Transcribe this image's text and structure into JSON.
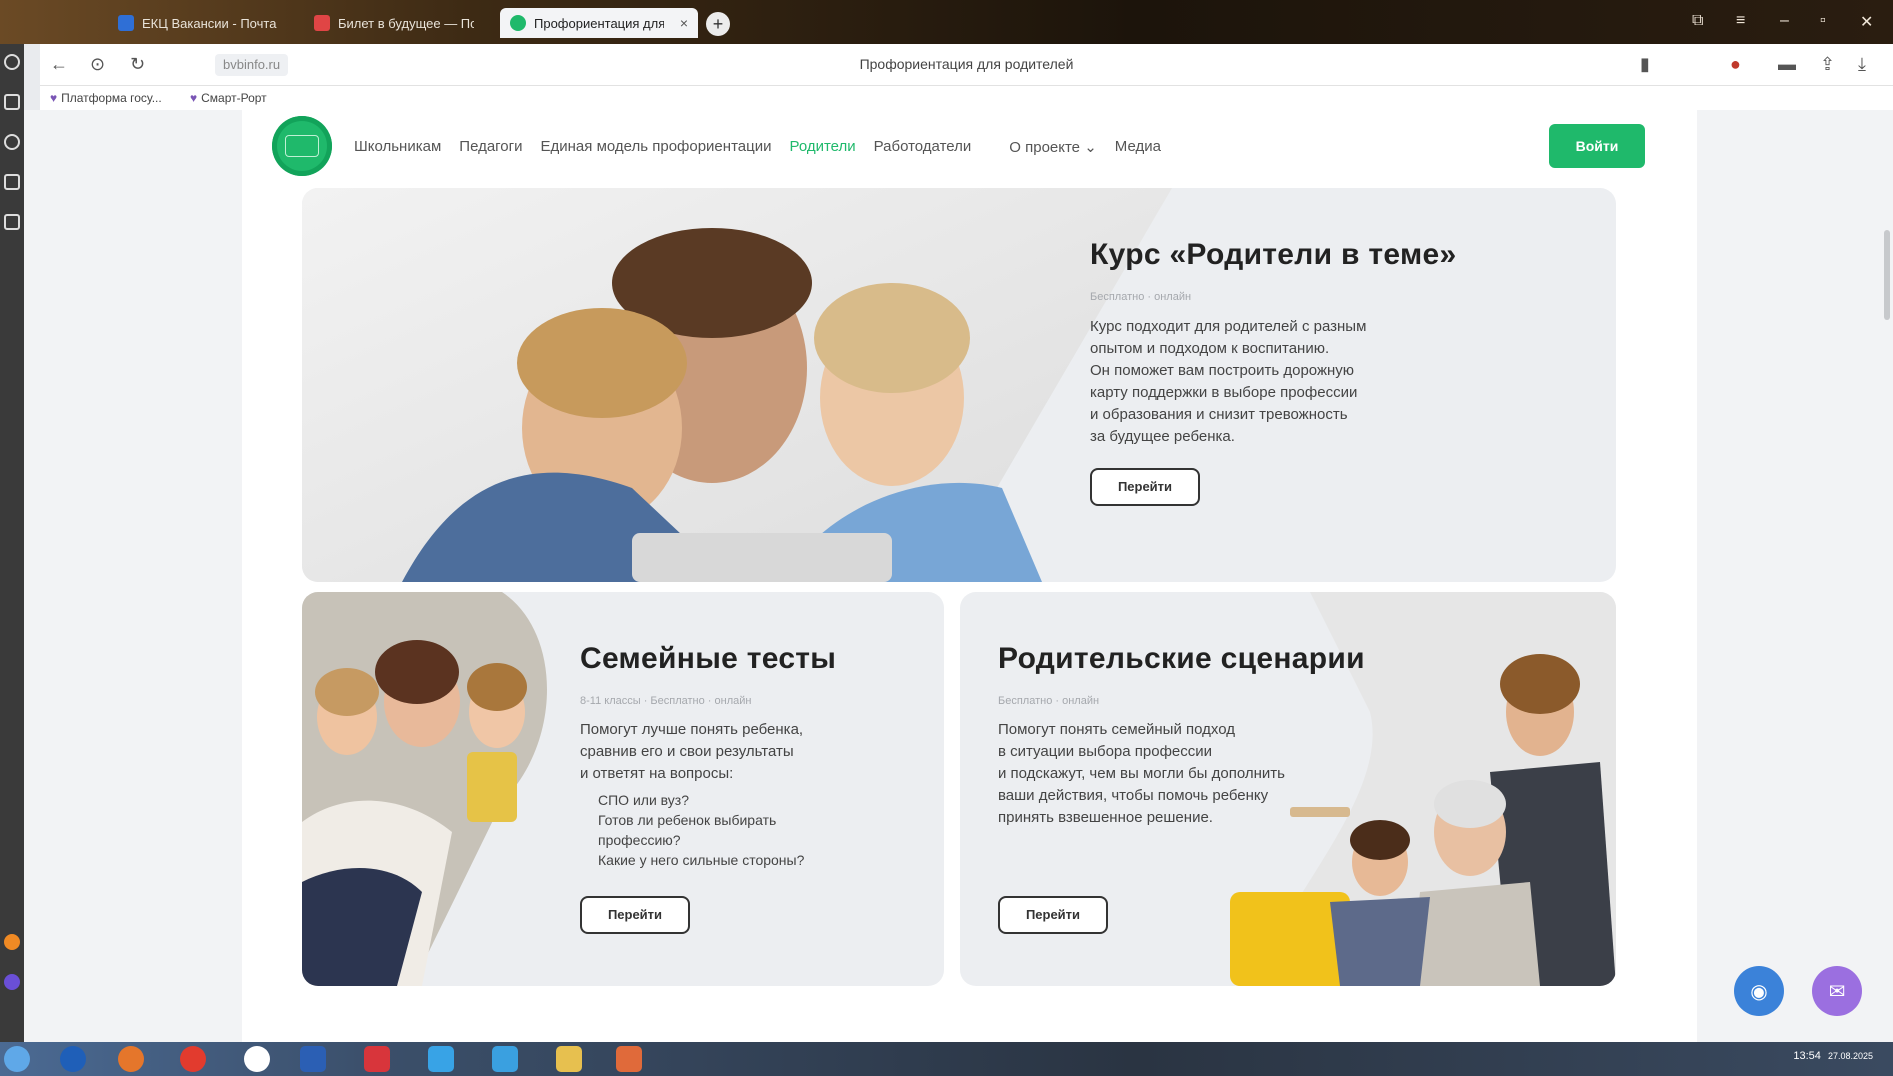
{
  "browser": {
    "tabs": [
      {
        "label": "ЕКЦ Вакансии - Почта",
        "active": false
      },
      {
        "label": "Билет в будущее — Портал",
        "active": false
      },
      {
        "label": "Профориентация для...",
        "active": true
      }
    ],
    "page_title": "Профориентация для родителей",
    "url": "bvbinfo.ru",
    "bookmarks": [
      "Платформа госу...",
      "Смарт-Рорт"
    ]
  },
  "site": {
    "nav": [
      "Школьникам",
      "Педагоги",
      "Единая модель профориентации",
      "Родители",
      "Работодатели",
      "О проекте",
      "Медиа"
    ],
    "active_nav": "Родители",
    "login_label": "Войти"
  },
  "cards": {
    "course": {
      "title": "Курс «Родители в теме»",
      "tags": "Бесплатно · онлайн",
      "description": [
        "Курс подходит для родителей с разным",
        "опытом и подходом к воспитанию.",
        "Он поможет вам построить дорожную",
        "карту поддержки в выборе профессии",
        "и образования и снизит тревожность",
        "за будущее ребенка."
      ],
      "button": "Перейти"
    },
    "tests": {
      "title": "Семейные тесты",
      "tags": "8-11 классы · Бесплатно · онлайн",
      "description": [
        "Помогут лучше понять ребенка,",
        "сравнив его и свои результаты",
        "и ответят на вопросы:"
      ],
      "questions": [
        "СПО или вуз?",
        "Готов ли ребенок выбирать",
        "профессию?",
        "Какие у него сильные стороны?"
      ],
      "button": "Перейти"
    },
    "scenarios": {
      "title": "Родительские сценарии",
      "tags": "Бесплатно · онлайн",
      "description": [
        "Помогут понять семейный подход",
        "в ситуации выбора профессии",
        "и подскажут, чем вы могли бы дополнить",
        "ваши действия, чтобы помочь ребенку",
        "принять взвешенное решение."
      ],
      "button": "Перейти"
    }
  },
  "colors": {
    "brand_green": "#1fb96b",
    "accessibility_btn": "#3b82d9",
    "chat_btn": "#9b6fe0"
  },
  "tray": {
    "time": "13:54",
    "date": "27.08.2025"
  }
}
